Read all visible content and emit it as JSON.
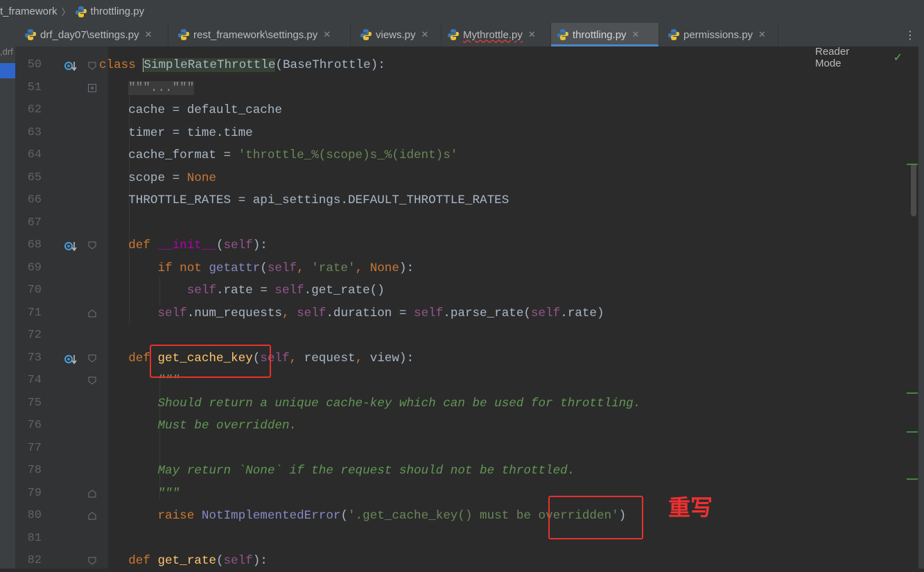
{
  "breadcrumb": [
    "t_framework",
    "throttling.py"
  ],
  "tabs": [
    {
      "label": "drf_day07\\settings.py",
      "active": false,
      "close": "✕"
    },
    {
      "label": "rest_framework\\settings.py",
      "active": false,
      "close": "✕"
    },
    {
      "label": "views.py",
      "active": false,
      "close": "✕"
    },
    {
      "label": "Mythrottle.py",
      "active": false,
      "close": "✕"
    },
    {
      "label": "throttling.py",
      "active": true,
      "close": "✕"
    },
    {
      "label": "permissions.py",
      "active": false,
      "close": "✕"
    }
  ],
  "tab_menu": "⋮",
  "project_panel": {
    "label": ",drf"
  },
  "reader_mode": {
    "label": "Reader Mode",
    "check": "✓"
  },
  "annotation": {
    "label": "重写",
    "color": "#e8322a"
  },
  "colors": {
    "keyword": "#cc7832",
    "self": "#94558d",
    "string": "#6a8759",
    "docstring": "#629755",
    "function": "#ffc66d",
    "accent": "#4a88c7"
  },
  "lines": [
    {
      "n": "50",
      "tokens": [
        {
          "t": "class ",
          "c": "kw"
        },
        {
          "t": "SimpleRateThrottle",
          "c": "hlcls caret"
        },
        {
          "t": "(BaseThrottle):"
        }
      ]
    },
    {
      "n": "51",
      "tokens": [
        {
          "t": "    "
        },
        {
          "t": "\"\"\"...\"\"\"",
          "c": "folded"
        }
      ]
    },
    {
      "n": "62",
      "tokens": [
        {
          "t": "    cache = default_cache"
        }
      ]
    },
    {
      "n": "63",
      "tokens": [
        {
          "t": "    timer = time.time"
        }
      ]
    },
    {
      "n": "64",
      "tokens": [
        {
          "t": "    cache_format = "
        },
        {
          "t": "'throttle_%(scope)s_%(ident)s'",
          "c": "str"
        }
      ]
    },
    {
      "n": "65",
      "tokens": [
        {
          "t": "    scope = "
        },
        {
          "t": "None",
          "c": "kw"
        }
      ]
    },
    {
      "n": "66",
      "tokens": [
        {
          "t": "    THROTTLE_RATES = api_settings.DEFAULT_THROTTLE_RATES"
        }
      ]
    },
    {
      "n": "67",
      "tokens": []
    },
    {
      "n": "68",
      "tokens": [
        {
          "t": "    "
        },
        {
          "t": "def ",
          "c": "kw"
        },
        {
          "t": "__init__",
          "c": "dunder"
        },
        {
          "t": "("
        },
        {
          "t": "self",
          "c": "self"
        },
        {
          "t": "):"
        }
      ]
    },
    {
      "n": "69",
      "tokens": [
        {
          "t": "        "
        },
        {
          "t": "if not ",
          "c": "kw"
        },
        {
          "t": "getattr",
          "c": "bi"
        },
        {
          "t": "("
        },
        {
          "t": "self",
          "c": "self"
        },
        {
          "t": ", ",
          "c": "kw"
        },
        {
          "t": "'rate'",
          "c": "str"
        },
        {
          "t": ", ",
          "c": "kw"
        },
        {
          "t": "None",
          "c": "kw"
        },
        {
          "t": "):"
        }
      ]
    },
    {
      "n": "70",
      "tokens": [
        {
          "t": "            "
        },
        {
          "t": "self",
          "c": "self"
        },
        {
          "t": ".rate = "
        },
        {
          "t": "self",
          "c": "self"
        },
        {
          "t": ".get_rate()"
        }
      ]
    },
    {
      "n": "71",
      "tokens": [
        {
          "t": "        "
        },
        {
          "t": "self",
          "c": "self"
        },
        {
          "t": ".num_requests"
        },
        {
          "t": ", ",
          "c": "kw"
        },
        {
          "t": "self",
          "c": "self"
        },
        {
          "t": ".duration = "
        },
        {
          "t": "self",
          "c": "self"
        },
        {
          "t": ".parse_rate("
        },
        {
          "t": "self",
          "c": "self"
        },
        {
          "t": ".rate)"
        }
      ]
    },
    {
      "n": "72",
      "tokens": []
    },
    {
      "n": "73",
      "tokens": [
        {
          "t": "    "
        },
        {
          "t": "def ",
          "c": "kw"
        },
        {
          "t": "get_cache_key",
          "c": "fn"
        },
        {
          "t": "("
        },
        {
          "t": "self",
          "c": "self"
        },
        {
          "t": ", ",
          "c": "kw"
        },
        {
          "t": "request"
        },
        {
          "t": ", ",
          "c": "kw"
        },
        {
          "t": "view):"
        }
      ]
    },
    {
      "n": "74",
      "tokens": [
        {
          "t": "        "
        },
        {
          "t": "\"\"\"",
          "c": "doc"
        }
      ]
    },
    {
      "n": "75",
      "tokens": [
        {
          "t": "        "
        },
        {
          "t": "Should return a unique cache-key which can be used for throttling.",
          "c": "doc"
        }
      ]
    },
    {
      "n": "76",
      "tokens": [
        {
          "t": "        "
        },
        {
          "t": "Must be overridden.",
          "c": "doc"
        }
      ]
    },
    {
      "n": "77",
      "tokens": []
    },
    {
      "n": "78",
      "tokens": [
        {
          "t": "        "
        },
        {
          "t": "May return `None` if the request should not be throttled.",
          "c": "doc"
        }
      ]
    },
    {
      "n": "79",
      "tokens": [
        {
          "t": "        "
        },
        {
          "t": "\"\"\"",
          "c": "doc"
        }
      ]
    },
    {
      "n": "80",
      "tokens": [
        {
          "t": "        "
        },
        {
          "t": "raise ",
          "c": "kw"
        },
        {
          "t": "NotImplementedError",
          "c": "bi"
        },
        {
          "t": "("
        },
        {
          "t": "'.get_cache_key() must be overridden'",
          "c": "str"
        },
        {
          "t": ")"
        }
      ]
    },
    {
      "n": "81",
      "tokens": []
    },
    {
      "n": "82",
      "tokens": [
        {
          "t": "    "
        },
        {
          "t": "def ",
          "c": "kw"
        },
        {
          "t": "get_rate",
          "c": "fn"
        },
        {
          "t": "("
        },
        {
          "t": "self",
          "c": "self"
        },
        {
          "t": "):"
        }
      ]
    }
  ]
}
